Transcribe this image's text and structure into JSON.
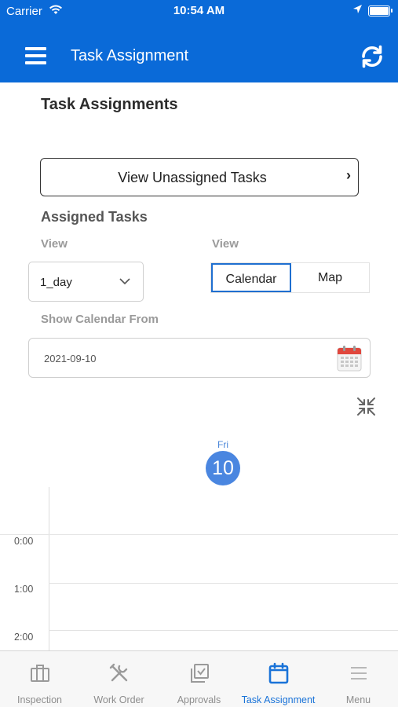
{
  "status_bar": {
    "carrier": "Carrier",
    "time": "10:54 AM"
  },
  "header": {
    "title": "Task Assignment",
    "menu_icon": "hamburger-menu-icon",
    "refresh_icon": "refresh-icon"
  },
  "main": {
    "page_title": "Task Assignments",
    "unassigned_button": "View Unassigned Tasks",
    "unassigned_chevron": "›",
    "assigned_title": "Assigned Tasks",
    "view_label_left": "View",
    "view_label_right": "View",
    "view_dropdown_value": "1_day",
    "view_toggle": {
      "options": [
        "Calendar",
        "Map"
      ],
      "selected": "Calendar"
    },
    "show_from_label": "Show Calendar From",
    "show_from_value": "2021-09-10"
  },
  "calendar": {
    "day_name": "Fri",
    "day_number": "10",
    "hours": [
      "0:00",
      "1:00",
      "2:00"
    ]
  },
  "tabbar": {
    "items": [
      {
        "label": "Inspection",
        "icon": "briefcase-icon"
      },
      {
        "label": "Work Order",
        "icon": "tools-icon"
      },
      {
        "label": "Approvals",
        "icon": "approvals-icon"
      },
      {
        "label": "Task Assignment",
        "icon": "calendar-icon"
      },
      {
        "label": "Menu",
        "icon": "menu-lines-icon"
      }
    ],
    "active": "Task Assignment"
  },
  "colors": {
    "primary": "#0a6ad8",
    "active_tab": "#1a73d8",
    "day_circle": "#4a86e0",
    "calendar_icon_red": "#e0473d"
  }
}
